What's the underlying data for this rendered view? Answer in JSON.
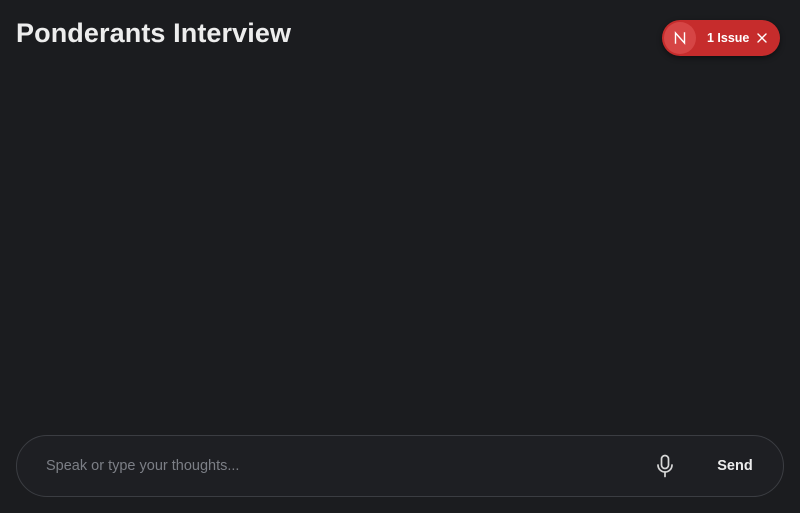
{
  "header": {
    "title": "Ponderants Interview"
  },
  "issue_indicator": {
    "badge_letter": "N",
    "label": "1 Issue",
    "color": "#c62c2c",
    "close_icon": "close-icon"
  },
  "composer": {
    "value": "",
    "placeholder": "Speak or type your thoughts...",
    "mic_icon": "microphone-icon",
    "send_label": "Send"
  },
  "colors": {
    "background": "#1b1c1f",
    "title": "#ededed",
    "border": "#3b3d42"
  }
}
